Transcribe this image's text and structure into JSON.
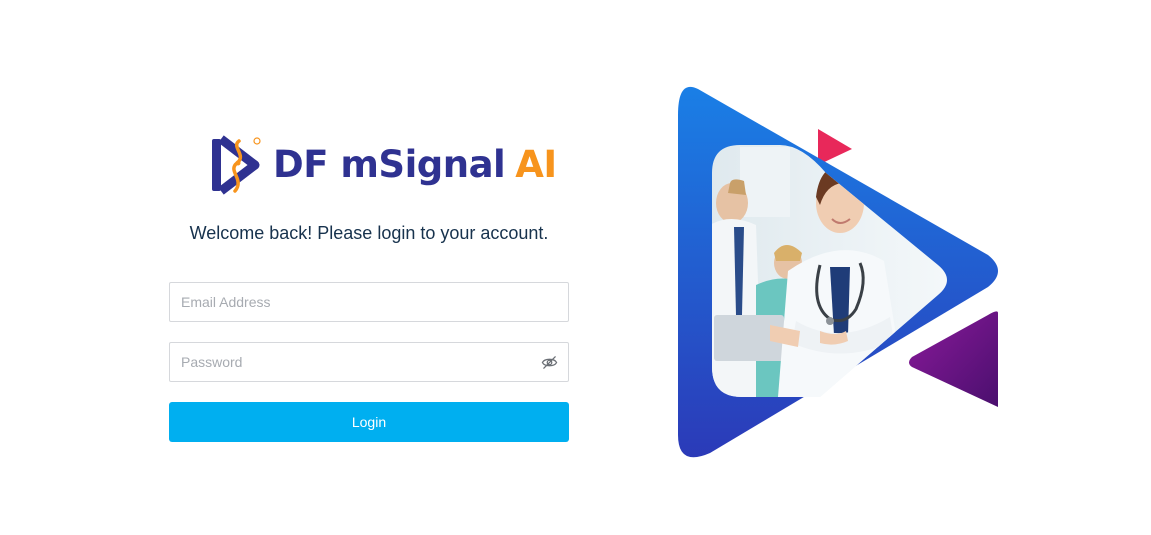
{
  "brand": {
    "name_main": "DF mSignal",
    "name_accent": "AI",
    "primary_color": "#2f3291",
    "accent_color": "#f7941d"
  },
  "welcome_text": "Welcome back! Please login to your account.",
  "form": {
    "email_placeholder": "Email Address",
    "password_placeholder": "Password",
    "password_toggle_icon": "eye-slash-icon",
    "login_label": "Login",
    "button_color": "#00aff0"
  },
  "hero": {
    "shapes": [
      "blue-play-triangle",
      "purple-triangle",
      "pink-triangle"
    ],
    "image": "doctor-photo"
  }
}
